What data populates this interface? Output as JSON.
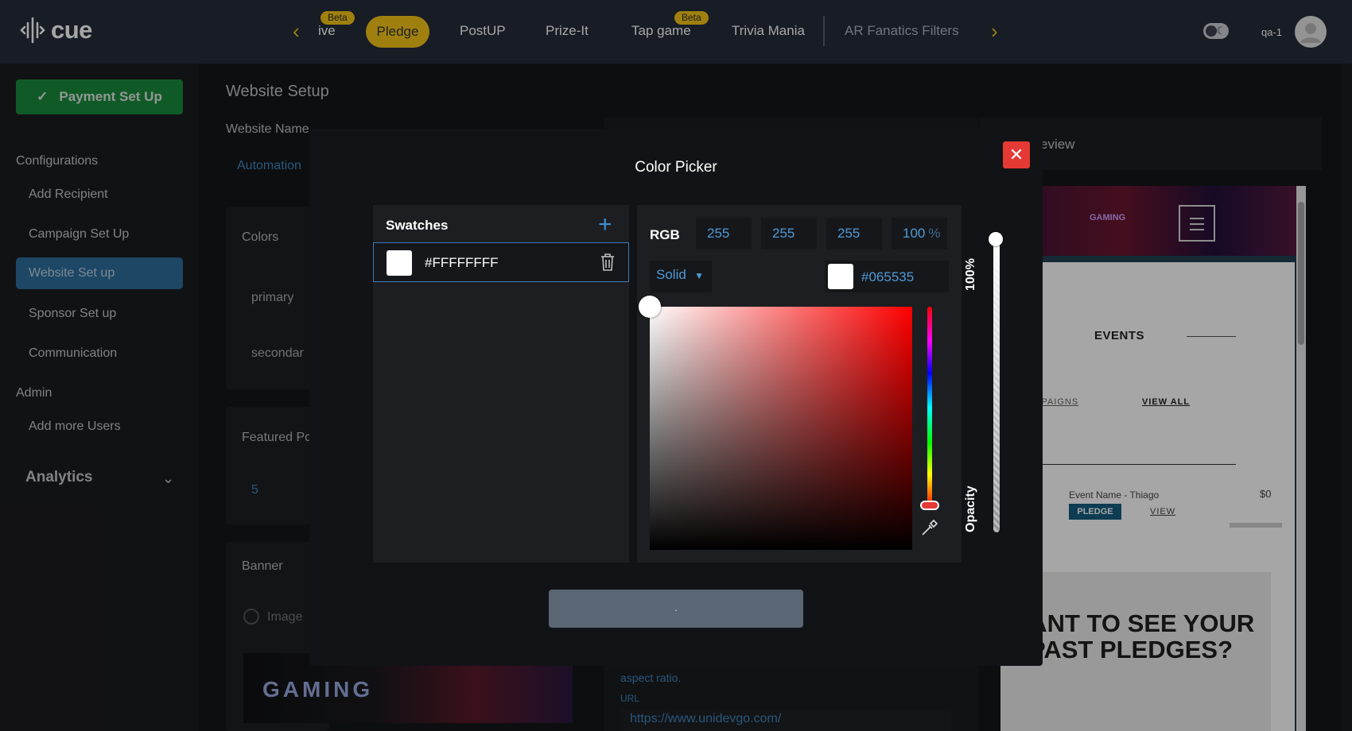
{
  "app": {
    "logo_text": "cue",
    "user_name": "qa-1"
  },
  "nav": {
    "items": [
      {
        "label": "ive",
        "badge": "Beta"
      },
      {
        "label": "Pledge",
        "active": true
      },
      {
        "label": "PostUP"
      },
      {
        "label": "Prize-It"
      },
      {
        "label": "Tap game",
        "badge": "Beta"
      },
      {
        "label": "Trivia Mania"
      },
      {
        "label": "AR Fanatics Filters"
      }
    ],
    "prev_icon": "chevron-left-icon",
    "next_icon": "chevron-right-icon",
    "accent_color": "#f5c518"
  },
  "sidebar": {
    "payment_button": "Payment Set Up",
    "sections": [
      {
        "heading": "Configurations",
        "items": [
          "Add Recipient",
          "Campaign Set Up",
          "Website Set up",
          "Sponsor Set up",
          "Communication"
        ]
      },
      {
        "heading": "Admin",
        "items": [
          "Add more Users"
        ]
      }
    ],
    "active_item": "Website Set up",
    "analytics_label": "Analytics"
  },
  "main": {
    "title": "Website Setup",
    "website_name_label": "Website Name",
    "website_name_value": "Automation",
    "colors_card": {
      "title": "Colors",
      "primary": "primary",
      "secondary": "secondar"
    },
    "featured_card": {
      "title": "Featured Pc",
      "value": "5"
    },
    "banner_card": {
      "title": "Banner",
      "radio_label": "Image",
      "image_text": "GAMING"
    },
    "aspect_text": "aspect ratio.",
    "url_label": "URL",
    "url_value": "https://www.unidevgo.com/",
    "preview_label": "eview"
  },
  "preview": {
    "events_heading": "EVENTS",
    "campaigns_link": "CAMPAIGNS",
    "view_all_link": "VIEW ALL",
    "event_name": "Event Name - Thiago",
    "event_amount": "$0",
    "pledge_button": "PLEDGE",
    "view_link": "VIEW",
    "past_pledges": "WANT TO SEE YOUR PAST PLEDGES?",
    "banner_logo_text": "GAMING"
  },
  "color_picker": {
    "title": "Color Picker",
    "swatches_title": "Swatches",
    "swatches": [
      {
        "hex": "#FFFFFFFF",
        "color": "#ffffff"
      }
    ],
    "mode_label": "RGB",
    "r": "255",
    "g": "255",
    "b": "255",
    "alpha": "100",
    "alpha_unit": "%",
    "fill_type": "Solid",
    "hex_value": "#065535",
    "hex_color": "#ffffff",
    "opacity_percent_label": "100%",
    "opacity_label": "Opacity",
    "opacity_value": 1.0,
    "hue_value": 0,
    "apply_button_label": "."
  }
}
